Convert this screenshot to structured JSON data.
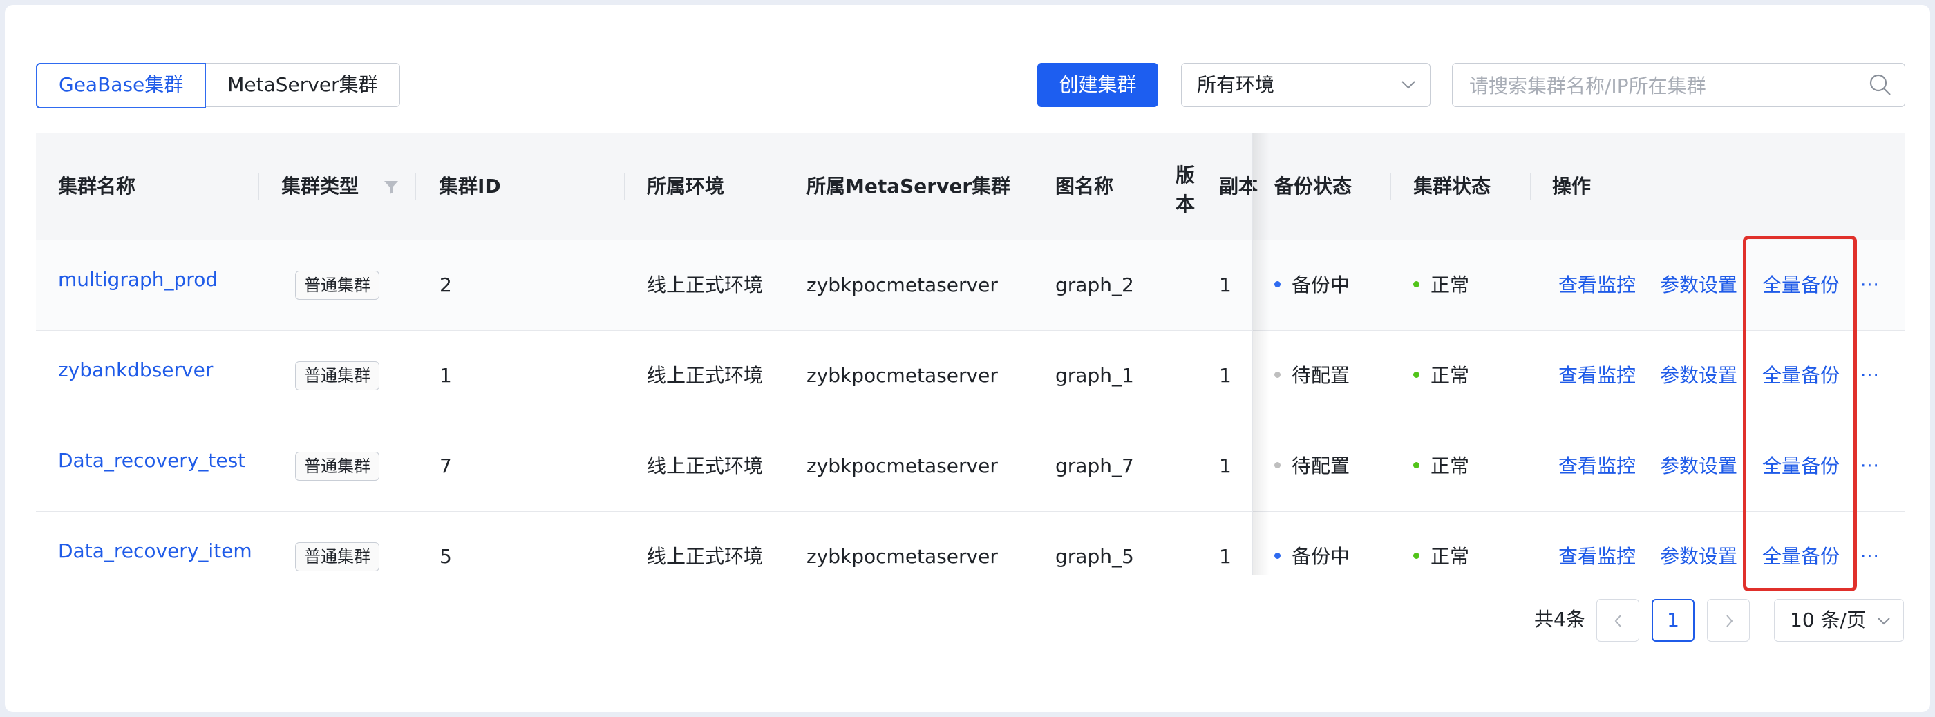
{
  "tabs": [
    {
      "label": "GeaBase集群",
      "active": true
    },
    {
      "label": "MetaServer集群",
      "active": false
    }
  ],
  "toolbar": {
    "create_label": "创建集群",
    "env_select_value": "所有环境",
    "search_placeholder": "请搜索集群名称/IP所在集群"
  },
  "table": {
    "headers": {
      "name": "集群名称",
      "type": "集群类型",
      "id": "集群ID",
      "env": "所属环境",
      "metaserver": "所属MetaServer集群",
      "graph": "图名称",
      "version_a": "版",
      "version_b": "本",
      "replica": "副本",
      "backup_status": "备份状态",
      "cluster_status": "集群状态",
      "actions": "操作"
    },
    "rows": [
      {
        "name": "multigraph_prod",
        "type": "普通集群",
        "id": "2",
        "env": "线上正式环境",
        "metaserver": "zybkpocmetaserver",
        "graph": "graph_2",
        "replica": "1",
        "backup": "备份中",
        "backup_color": "#2f6bf0",
        "status": "正常",
        "status_color": "#52c41a",
        "action_monitor": "查看监控",
        "action_params": "参数设置",
        "action_backup": "全量备份",
        "more": "···"
      },
      {
        "name": "zybankdbserver",
        "type": "普通集群",
        "id": "1",
        "env": "线上正式环境",
        "metaserver": "zybkpocmetaserver",
        "graph": "graph_1",
        "replica": "1",
        "backup": "待配置",
        "backup_color": "#bfbfbf",
        "status": "正常",
        "status_color": "#52c41a",
        "action_monitor": "查看监控",
        "action_params": "参数设置",
        "action_backup": "全量备份",
        "more": "···"
      },
      {
        "name": "Data_recovery_test",
        "type": "普通集群",
        "id": "7",
        "env": "线上正式环境",
        "metaserver": "zybkpocmetaserver",
        "graph": "graph_7",
        "replica": "1",
        "backup": "待配置",
        "backup_color": "#bfbfbf",
        "status": "正常",
        "status_color": "#52c41a",
        "action_monitor": "查看监控",
        "action_params": "参数设置",
        "action_backup": "全量备份",
        "more": "···"
      },
      {
        "name": "Data_recovery_item",
        "type": "普通集群",
        "id": "5",
        "env": "线上正式环境",
        "metaserver": "zybkpocmetaserver",
        "graph": "graph_5",
        "replica": "1",
        "backup": "备份中",
        "backup_color": "#2f6bf0",
        "status": "正常",
        "status_color": "#52c41a",
        "action_monitor": "查看监控",
        "action_params": "参数设置",
        "action_backup": "全量备份",
        "more": "···"
      }
    ]
  },
  "pagination": {
    "total": "共4条",
    "current_page": "1",
    "page_size": "10 条/页"
  },
  "colors": {
    "primary": "#1f5be8",
    "highlight": "#e0302b"
  }
}
